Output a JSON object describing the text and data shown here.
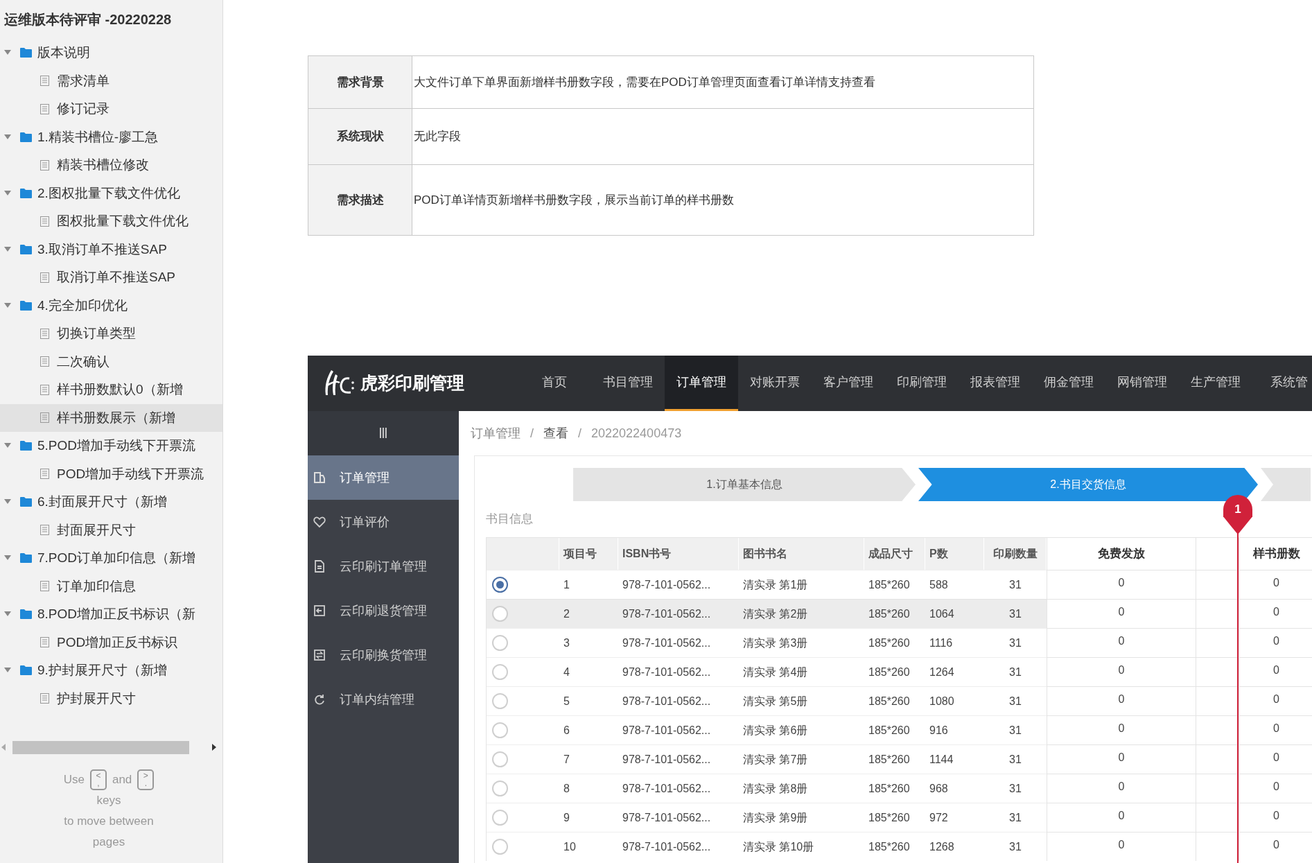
{
  "sidebar": {
    "title": "运维版本待评审 -20220228",
    "tree": [
      {
        "kind": "folder",
        "label": "版本说明",
        "expanded": true,
        "selected": false,
        "children": [
          {
            "kind": "page",
            "label": "需求清单",
            "selected": false
          },
          {
            "kind": "page",
            "label": "修订记录",
            "selected": false
          }
        ]
      },
      {
        "kind": "folder",
        "label": "1.精装书槽位-廖工急",
        "expanded": true,
        "selected": false,
        "children": [
          {
            "kind": "page",
            "label": "精装书槽位修改",
            "selected": false
          }
        ]
      },
      {
        "kind": "folder",
        "label": "2.图权批量下载文件优化",
        "expanded": true,
        "selected": false,
        "children": [
          {
            "kind": "page",
            "label": "图权批量下载文件优化",
            "selected": false
          }
        ]
      },
      {
        "kind": "folder",
        "label": "3.取消订单不推送SAP",
        "expanded": true,
        "selected": false,
        "children": [
          {
            "kind": "page",
            "label": "取消订单不推送SAP",
            "selected": false
          }
        ]
      },
      {
        "kind": "folder",
        "label": "4.完全加印优化",
        "expanded": true,
        "selected": false,
        "children": [
          {
            "kind": "page",
            "label": "切换订单类型",
            "selected": false
          },
          {
            "kind": "page",
            "label": "二次确认",
            "selected": false
          },
          {
            "kind": "page",
            "label": "样书册数默认0（新增",
            "selected": false
          },
          {
            "kind": "page",
            "label": "样书册数展示（新增",
            "selected": true
          }
        ]
      },
      {
        "kind": "folder",
        "label": "5.POD增加手动线下开票流",
        "expanded": true,
        "selected": false,
        "children": [
          {
            "kind": "page",
            "label": "POD增加手动线下开票流",
            "selected": false
          }
        ]
      },
      {
        "kind": "folder",
        "label": "6.封面展开尺寸（新增",
        "expanded": true,
        "selected": false,
        "children": [
          {
            "kind": "page",
            "label": "封面展开尺寸",
            "selected": false
          }
        ]
      },
      {
        "kind": "folder",
        "label": "7.POD订单加印信息（新增",
        "expanded": true,
        "selected": false,
        "children": [
          {
            "kind": "page",
            "label": "订单加印信息",
            "selected": false
          }
        ]
      },
      {
        "kind": "folder",
        "label": "8.POD增加正反书标识（新",
        "expanded": true,
        "selected": false,
        "children": [
          {
            "kind": "page",
            "label": "POD增加正反书标识",
            "selected": false
          }
        ]
      },
      {
        "kind": "folder",
        "label": "9.护封展开尺寸（新增",
        "expanded": true,
        "selected": false,
        "children": [
          {
            "kind": "page",
            "label": "护封展开尺寸",
            "selected": false
          }
        ]
      }
    ],
    "hint": {
      "before": "Use",
      "key_prev": [
        "<",
        ","
      ],
      "middle": "and",
      "key_next": [
        ">",
        "."
      ],
      "line_2": "keys",
      "line_3": "to move between pages"
    }
  },
  "requirements": [
    {
      "label": "需求背景",
      "text": "大文件订单下单界面新增样书册数字段，需要在POD订单管理页面查看订单详情支持查看"
    },
    {
      "label": "系统现状",
      "text": "无此字段"
    },
    {
      "label": "需求描述",
      "text": "POD订单详情页新增样书册数字段，展示当前订单的样书册数"
    }
  ],
  "app": {
    "brand": "虎彩印刷管理",
    "nav": [
      {
        "label": "首页",
        "selected": false
      },
      {
        "label": "书目管理",
        "selected": false
      },
      {
        "label": "订单管理",
        "selected": true
      },
      {
        "label": "对账开票",
        "selected": false
      },
      {
        "label": "客户管理",
        "selected": false
      },
      {
        "label": "印刷管理",
        "selected": false
      },
      {
        "label": "报表管理",
        "selected": false
      },
      {
        "label": "佣金管理",
        "selected": false
      },
      {
        "label": "网销管理",
        "selected": false
      },
      {
        "label": "生产管理",
        "selected": false
      },
      {
        "label": "系统管",
        "selected": false
      }
    ],
    "menu_toggle": "Ⅲ",
    "menu": [
      {
        "label": "订单管理",
        "selected": true
      },
      {
        "label": "订单评价",
        "selected": false
      },
      {
        "label": "云印刷订单管理",
        "selected": false
      },
      {
        "label": "云印刷退货管理",
        "selected": false
      },
      {
        "label": "云印刷换货管理",
        "selected": false
      },
      {
        "label": "订单内结管理",
        "selected": false
      }
    ],
    "breadcrumb": [
      {
        "kind": "link",
        "text": "订单管理"
      },
      {
        "kind": "separator",
        "text": "/"
      },
      {
        "kind": "link",
        "text": "查看"
      },
      {
        "kind": "separator",
        "text": "/"
      },
      {
        "kind": "current",
        "text": "2022022400473"
      }
    ],
    "steps": [
      {
        "label": "1.订单基本信息",
        "selected": false
      },
      {
        "label": "2.书目交货信息",
        "selected": true
      },
      {
        "selected": false
      }
    ],
    "annotation": {
      "marker": "1"
    },
    "section_title": "书目信息",
    "table": {
      "columns": [
        {
          "kind": "radio"
        },
        {
          "kind": "text",
          "label": "项目号"
        },
        {
          "kind": "text",
          "label": "ISBN书号"
        },
        {
          "kind": "text",
          "label": "图书书名"
        },
        {
          "kind": "text",
          "label": "成品尺寸"
        },
        {
          "kind": "text",
          "label": "P数"
        },
        {
          "kind": "center",
          "label": "印刷数量"
        },
        {
          "kind": "wide",
          "label": "免费发放"
        },
        {
          "kind": "blank"
        },
        {
          "kind": "wide",
          "label": "样书册数"
        }
      ],
      "rows": [
        {
          "selected": true,
          "hovered": false,
          "cells": [
            "",
            "1",
            "978-7-101-0562...",
            "清实录 第1册",
            "185*260",
            "588",
            "31",
            "0",
            "",
            "0"
          ]
        },
        {
          "selected": false,
          "hovered": true,
          "cells": [
            "",
            "2",
            "978-7-101-0562...",
            "清实录 第2册",
            "185*260",
            "1064",
            "31",
            "0",
            "",
            "0"
          ]
        },
        {
          "selected": false,
          "hovered": false,
          "cells": [
            "",
            "3",
            "978-7-101-0562...",
            "清实录 第3册",
            "185*260",
            "1116",
            "31",
            "0",
            "",
            "0"
          ]
        },
        {
          "selected": false,
          "hovered": false,
          "cells": [
            "",
            "4",
            "978-7-101-0562...",
            "清实录 第4册",
            "185*260",
            "1264",
            "31",
            "0",
            "",
            "0"
          ]
        },
        {
          "selected": false,
          "hovered": false,
          "cells": [
            "",
            "5",
            "978-7-101-0562...",
            "清实录 第5册",
            "185*260",
            "1080",
            "31",
            "0",
            "",
            "0"
          ]
        },
        {
          "selected": false,
          "hovered": false,
          "cells": [
            "",
            "6",
            "978-7-101-0562...",
            "清实录 第6册",
            "185*260",
            "916",
            "31",
            "0",
            "",
            "0"
          ]
        },
        {
          "selected": false,
          "hovered": false,
          "cells": [
            "",
            "7",
            "978-7-101-0562...",
            "清实录 第7册",
            "185*260",
            "1144",
            "31",
            "0",
            "",
            "0"
          ]
        },
        {
          "selected": false,
          "hovered": false,
          "cells": [
            "",
            "8",
            "978-7-101-0562...",
            "清实录 第8册",
            "185*260",
            "968",
            "31",
            "0",
            "",
            "0"
          ]
        },
        {
          "selected": false,
          "hovered": false,
          "cells": [
            "",
            "9",
            "978-7-101-0562...",
            "清实录 第9册",
            "185*260",
            "972",
            "31",
            "0",
            "",
            "0"
          ]
        },
        {
          "selected": false,
          "hovered": false,
          "cells": [
            "",
            "10",
            "978-7-101-0562...",
            "清实录 第10册",
            "185*260",
            "1268",
            "31",
            "0",
            "",
            "0"
          ]
        }
      ]
    }
  }
}
